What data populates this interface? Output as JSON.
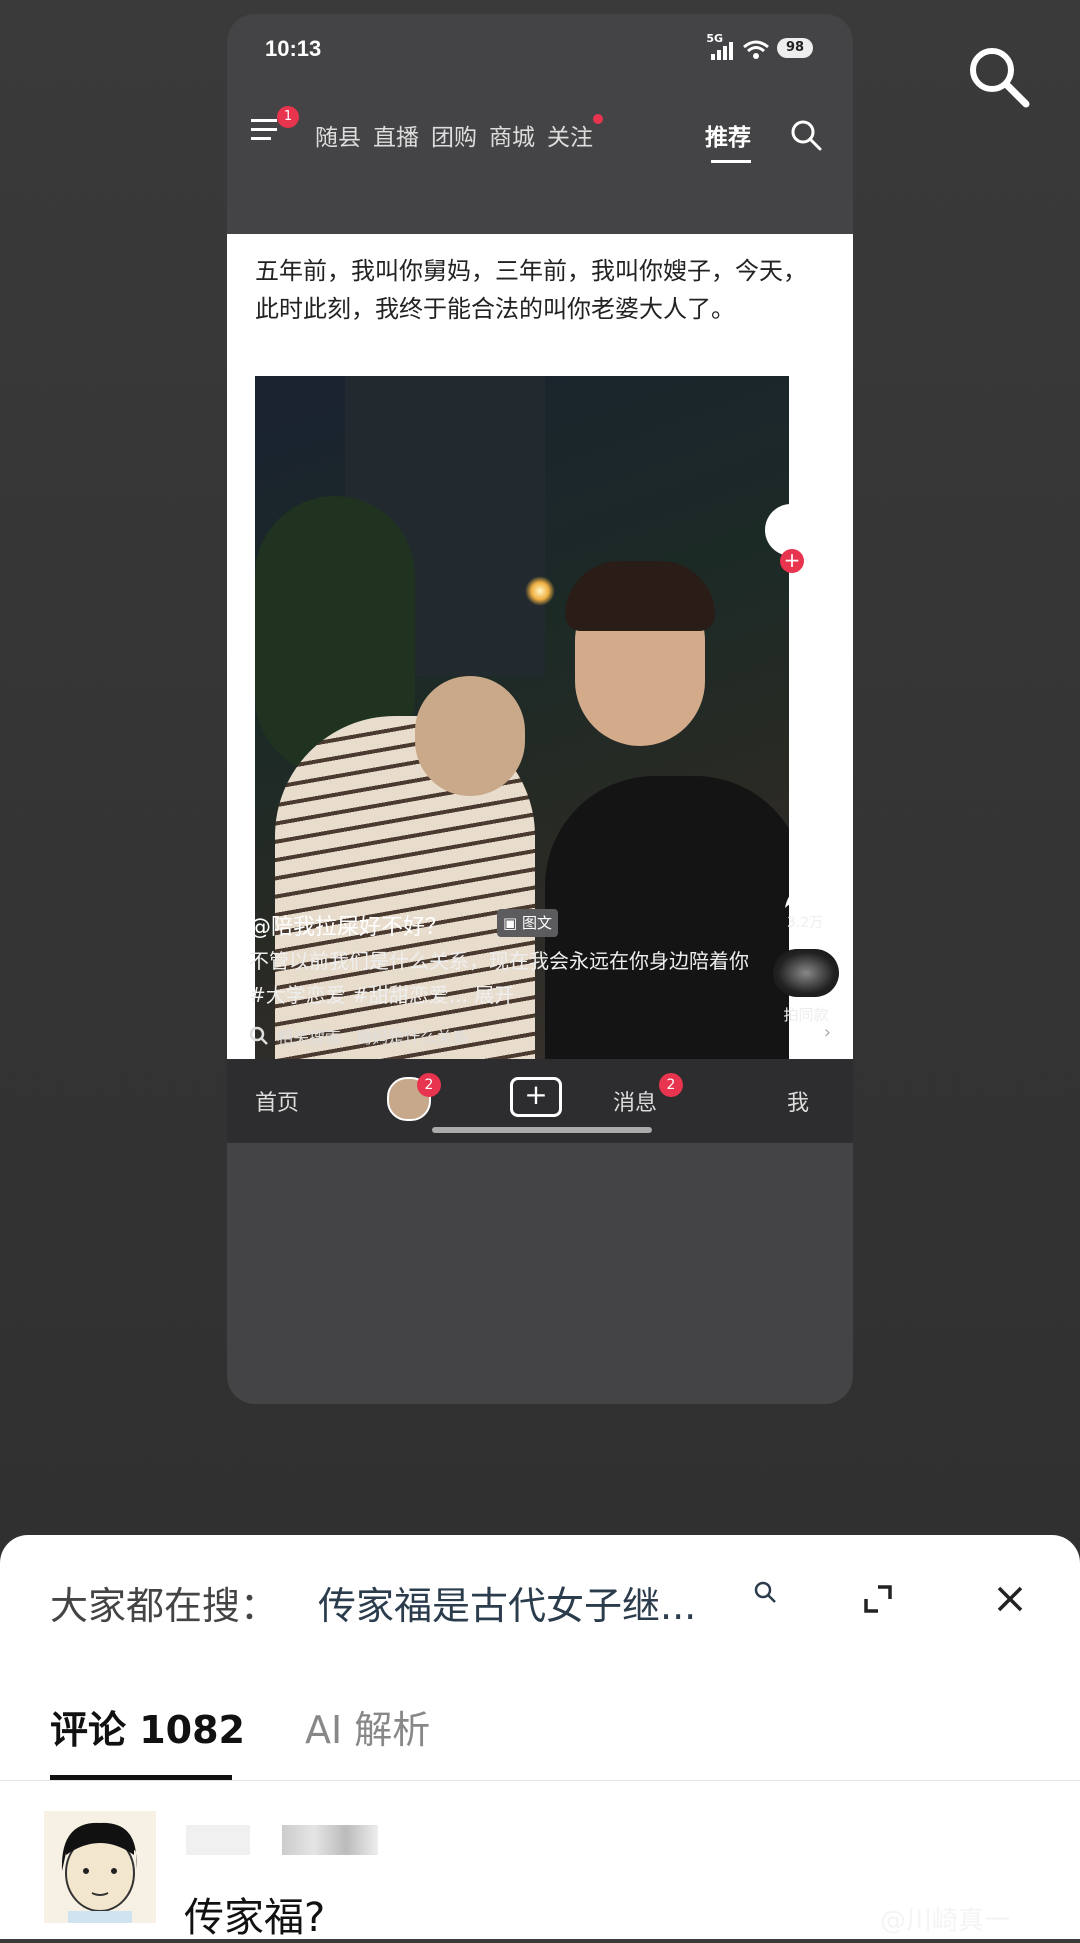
{
  "status": {
    "time": "10:13",
    "network": "5G",
    "battery": "98"
  },
  "topnav": {
    "menu_badge": "1",
    "tabs": [
      "随县",
      "直播",
      "团购",
      "商城",
      "关注",
      "推荐"
    ]
  },
  "post": {
    "text": "五年前，我叫你舅妈，三年前，我叫你嫂子，今天，此时此刻，我终于能合法的叫你老婆大人了。",
    "author": "@陪我拉屎好不好？",
    "type_tag": "图文",
    "description": "不管以前我们是什么关系，现在我会永远在你身边陪着你#大学恋爱 #甜甜恋爱... 展开",
    "share_count": "3.2万",
    "same_style_label": "拍同款",
    "related_search": "相关搜索 · 舅妈是什么关系"
  },
  "bottombar": {
    "home": "首页",
    "friends_badge": "2",
    "messages": "消息",
    "messages_badge": "2",
    "me": "我"
  },
  "sheet": {
    "hot_prefix": "大家都在搜：",
    "hot_query": "传家福是古代女子继...",
    "tab_comments": "评论 1082",
    "tab_ai": "AI 解析",
    "comment_text": "传家福?"
  },
  "watermark": "@川崎真一"
}
